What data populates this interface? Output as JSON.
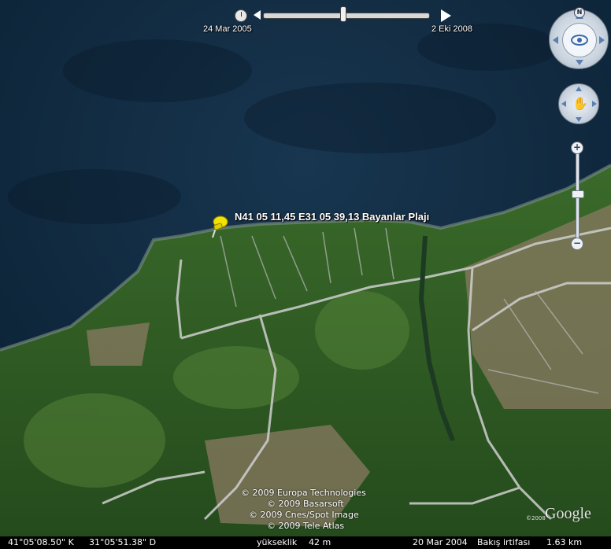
{
  "time_slider": {
    "start_date": "24 Mar 2005",
    "end_date": "2 Eki 2008"
  },
  "navigation": {
    "north_label": "N",
    "icons": [
      "clock-icon",
      "eye-icon",
      "hand-icon",
      "zoom-in-icon",
      "zoom-out-icon"
    ],
    "zoom_in": "+",
    "zoom_out": "−"
  },
  "placemark": {
    "label": "N41 05 11,45  E31 05 39,13 Bayanlar Plajı",
    "icon": "yellow-pushpin-icon",
    "color": "#f2e200"
  },
  "copyright": [
    "© 2009 Europa Technologies",
    "© 2009 Basarsoft",
    "© 2009 Cnes/Spot Image",
    "© 2009 Tele Atlas"
  ],
  "logo": {
    "text": "Google",
    "small": "©2008"
  },
  "status_bar": {
    "lat": "41°05'08.50\" K",
    "lon": "31°05'51.38\" D",
    "elevation_label": "yükseklik",
    "elevation_value": "42 m",
    "imagery_date": "20 Mar 2004",
    "eye_alt_label": "Bakış irtifası",
    "eye_alt_value": "1.63 km"
  },
  "colors": {
    "sea": "#0f2a40",
    "land": "#2d5a24",
    "road": "#cfcfcf"
  }
}
